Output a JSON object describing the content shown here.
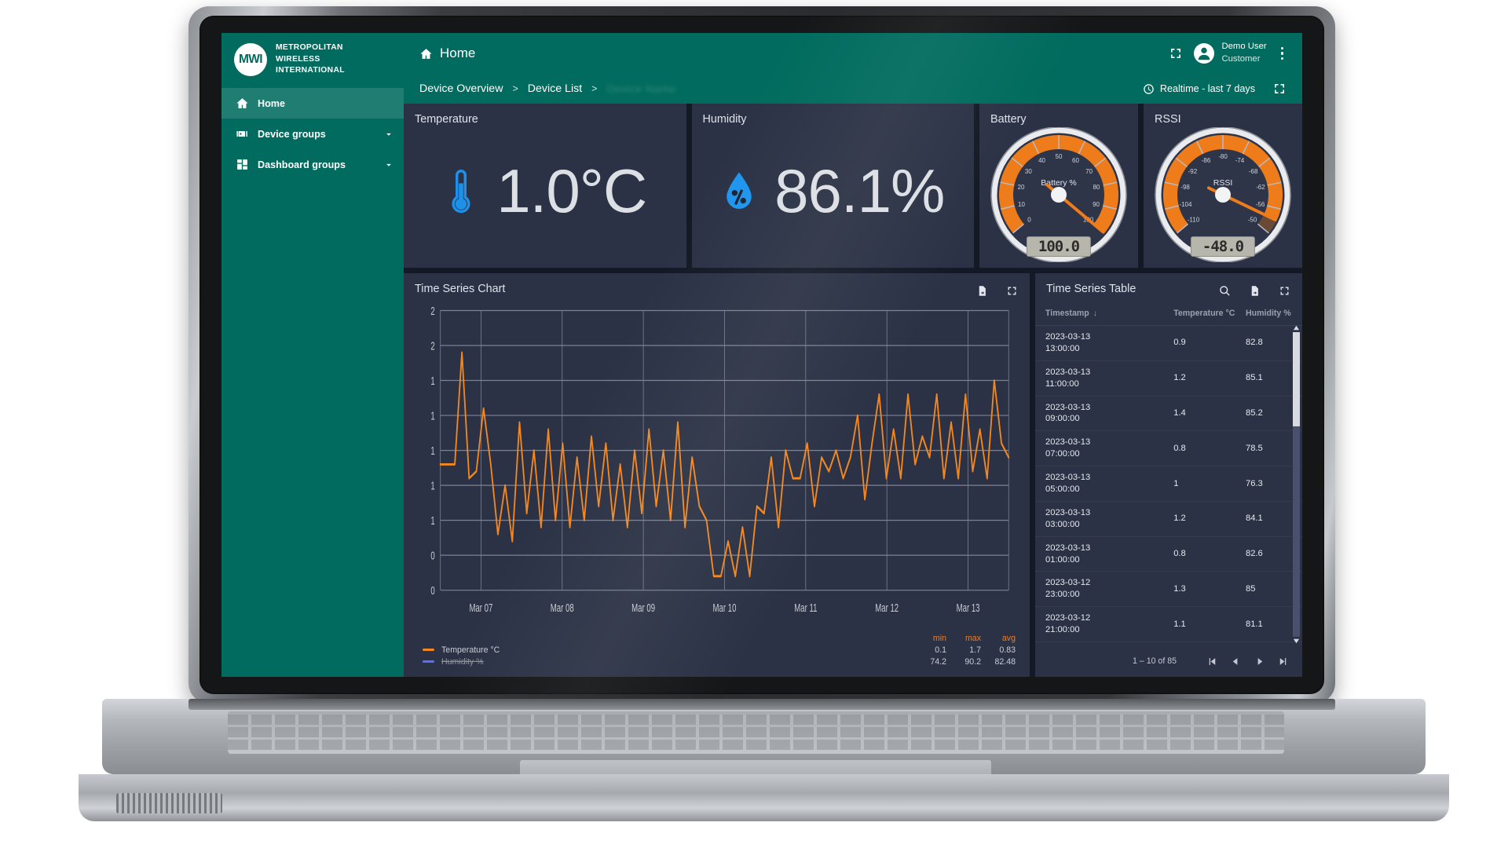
{
  "brand": {
    "logo_text": "MWI",
    "line1": "METROPOLITAN",
    "line2": "WIRELESS",
    "line3": "INTERNATIONAL",
    "color": "#006b5e"
  },
  "sidebar": {
    "items": [
      {
        "label": "Home",
        "icon": "home-icon",
        "active": true,
        "expandable": false
      },
      {
        "label": "Device groups",
        "icon": "device-groups-icon",
        "active": false,
        "expandable": true
      },
      {
        "label": "Dashboard groups",
        "icon": "dashboard-groups-icon",
        "active": false,
        "expandable": true
      }
    ]
  },
  "header": {
    "page_title": "Home",
    "fullscreen_icon": "fullscreen-icon",
    "user_name": "Demo User",
    "user_role": "Customer",
    "menu_icon": "kebab-menu-icon",
    "breadcrumbs": [
      {
        "label": "Device Overview"
      },
      {
        "label": "Device List"
      }
    ],
    "breadcrumb_separator": ">",
    "breadcrumb_trailing_blurred": "Device Name",
    "time_range": "Realtime - last 7 days",
    "time_range_icon": "clock-icon",
    "dashboard_fullscreen_icon": "fullscreen-icon"
  },
  "cards": {
    "temperature": {
      "title": "Temperature",
      "value": "1.0°C",
      "icon": "thermometer-icon",
      "icon_color": "#1e90e8"
    },
    "humidity": {
      "title": "Humidity",
      "value": "86.1%",
      "icon": "humidity-droplet-icon",
      "icon_color": "#1e95ef"
    },
    "battery": {
      "title": "Battery",
      "gauge_label": "Battery %",
      "readout": "100.0",
      "value": 100,
      "min": 0,
      "max": 100,
      "ticks": [
        "0",
        "10",
        "20",
        "30",
        "40",
        "50",
        "60",
        "70",
        "80",
        "90",
        "100"
      ]
    },
    "rssi": {
      "title": "RSSI",
      "gauge_label": "RSSI",
      "readout": "-48.0",
      "value": -48,
      "min": -116,
      "max": -44,
      "ticks": [
        "-110",
        "-104",
        "-98",
        "-92",
        "-86",
        "-80",
        "-74",
        "-68",
        "-62",
        "-56",
        "-50"
      ]
    }
  },
  "chart_card": {
    "title": "Time Series Chart",
    "export_icon": "export-file-icon",
    "fullscreen_icon": "fullscreen-icon",
    "legend_headers": [
      "min",
      "max",
      "avg"
    ],
    "legend": [
      {
        "name": "Temperature °C",
        "color": "#f5871f",
        "disabled": false,
        "min": "0.1",
        "max": "1.7",
        "avg": "0.83"
      },
      {
        "name": "Humidity %",
        "color": "#5e6ef0",
        "disabled": true,
        "min": "74.2",
        "max": "90.2",
        "avg": "82.48"
      }
    ]
  },
  "chart_data": {
    "type": "line",
    "title": "Time Series Chart",
    "xlabel": "",
    "ylabel": "",
    "grid": true,
    "legend_position": "bottom-left",
    "x_tick_labels": [
      "Mar 07",
      "Mar 08",
      "Mar 09",
      "Mar 10",
      "Mar 11",
      "Mar 12",
      "Mar 13"
    ],
    "y_tick_labels": [
      "2",
      "2",
      "1",
      "1",
      "1",
      "1",
      "1",
      "0",
      "0"
    ],
    "ylim": [
      0.0,
      2.0
    ],
    "series": [
      {
        "name": "Temperature °C",
        "color": "#f5871f",
        "visible": true,
        "min": 0.1,
        "max": 1.7,
        "avg": 0.83,
        "values": [
          0.9,
          0.9,
          0.9,
          1.7,
          0.8,
          0.85,
          1.3,
          0.9,
          0.4,
          0.75,
          0.35,
          1.2,
          0.55,
          1.0,
          0.45,
          1.15,
          0.5,
          1.05,
          0.45,
          0.95,
          0.5,
          1.1,
          0.6,
          1.05,
          0.5,
          0.9,
          0.45,
          1.0,
          0.55,
          1.15,
          0.6,
          1.0,
          0.5,
          1.2,
          0.45,
          0.95,
          0.6,
          0.5,
          0.1,
          0.1,
          0.35,
          0.1,
          0.45,
          0.1,
          0.6,
          0.55,
          0.95,
          0.45,
          1.0,
          0.8,
          0.8,
          1.05,
          0.6,
          0.95,
          0.85,
          1.0,
          0.8,
          0.95,
          1.25,
          0.65,
          1.05,
          1.4,
          0.8,
          1.15,
          0.8,
          1.4,
          0.9,
          1.1,
          0.95,
          1.4,
          0.8,
          1.2,
          0.8,
          1.4,
          0.85,
          1.15,
          0.8,
          1.5,
          1.05,
          0.95
        ]
      },
      {
        "name": "Humidity %",
        "color": "#5e6ef0",
        "visible": false,
        "min": 74.2,
        "max": 90.2,
        "avg": 82.48,
        "values": []
      }
    ]
  },
  "table_card": {
    "title": "Time Series Table",
    "search_icon": "search-icon",
    "export_icon": "export-file-icon",
    "fullscreen_icon": "fullscreen-icon",
    "columns": [
      "Timestamp",
      "Temperature °C",
      "Humidity %"
    ],
    "sort_column": "Timestamp",
    "sort_direction": "desc",
    "rows": [
      {
        "date": "2023-03-13",
        "time": "13:00:00",
        "temperature": "0.9",
        "humidity": "82.8"
      },
      {
        "date": "2023-03-13",
        "time": "11:00:00",
        "temperature": "1.2",
        "humidity": "85.1"
      },
      {
        "date": "2023-03-13",
        "time": "09:00:00",
        "temperature": "1.4",
        "humidity": "85.2"
      },
      {
        "date": "2023-03-13",
        "time": "07:00:00",
        "temperature": "0.8",
        "humidity": "78.5"
      },
      {
        "date": "2023-03-13",
        "time": "05:00:00",
        "temperature": "1",
        "humidity": "76.3"
      },
      {
        "date": "2023-03-13",
        "time": "03:00:00",
        "temperature": "1.2",
        "humidity": "84.1"
      },
      {
        "date": "2023-03-13",
        "time": "01:00:00",
        "temperature": "0.8",
        "humidity": "82.6"
      },
      {
        "date": "2023-03-12",
        "time": "23:00:00",
        "temperature": "1.3",
        "humidity": "85"
      },
      {
        "date": "2023-03-12",
        "time": "21:00:00",
        "temperature": "1.1",
        "humidity": "81.1"
      }
    ],
    "pager": {
      "range_label": "1 – 10 of 85",
      "first_label": "|<",
      "prev_label": "<",
      "next_label": ">",
      "last_label": ">|"
    }
  }
}
